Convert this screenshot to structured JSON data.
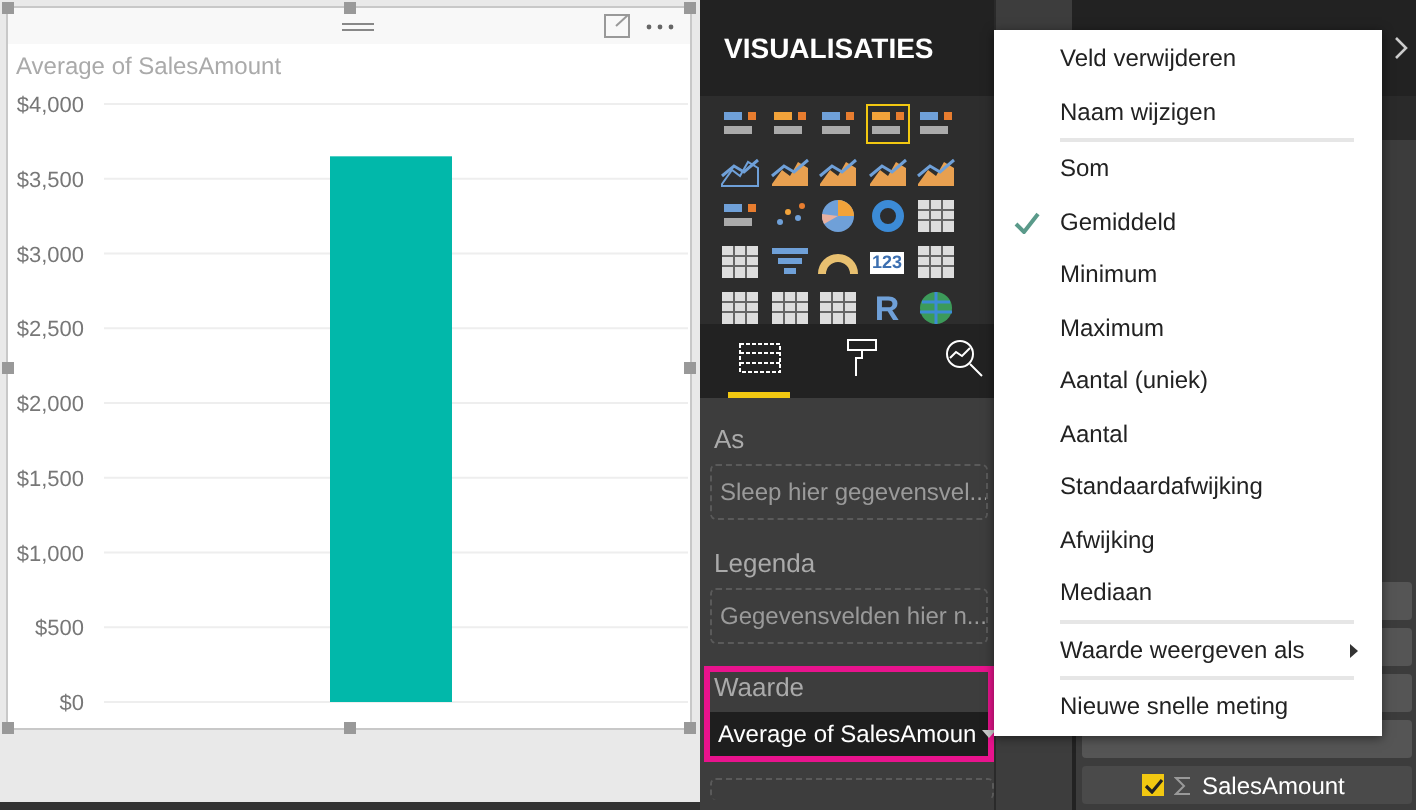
{
  "visual": {
    "title": "Average of SalesAmount",
    "chart_data": {
      "type": "bar",
      "grid": true,
      "values": [
        3650
      ],
      "ylim": [
        0,
        4000
      ],
      "yticks": [
        {
          "value": 0,
          "label": "$0"
        },
        {
          "value": 500,
          "label": "$500"
        },
        {
          "value": 1000,
          "label": "$1,000"
        },
        {
          "value": 1500,
          "label": "$1,500"
        },
        {
          "value": 2000,
          "label": "$2,000"
        },
        {
          "value": 2500,
          "label": "$2,500"
        },
        {
          "value": 3000,
          "label": "$3,000"
        },
        {
          "value": 3500,
          "label": "$3,500"
        },
        {
          "value": 4000,
          "label": "$4,000"
        }
      ]
    }
  },
  "visualizations": {
    "title": "VISUALISATIES",
    "types": [
      {
        "selected": false
      },
      {
        "selected": false
      },
      {
        "selected": false
      },
      {
        "selected": true
      },
      {
        "selected": false
      },
      {
        "selected": false
      },
      {
        "selected": false
      },
      {
        "selected": false
      },
      {
        "selected": false
      },
      {
        "selected": false
      },
      {
        "selected": false
      },
      {
        "selected": false
      },
      {
        "selected": false
      },
      {
        "selected": false
      },
      {
        "selected": false
      },
      {
        "selected": false
      },
      {
        "selected": false
      },
      {
        "selected": false
      },
      {
        "selected": false,
        "label": "123"
      },
      {
        "selected": false
      },
      {
        "selected": false
      },
      {
        "selected": false
      },
      {
        "selected": false
      },
      {
        "selected": false,
        "label": "R"
      },
      {
        "selected": false
      }
    ],
    "tabs": [
      {
        "selected": true
      },
      {
        "selected": false
      },
      {
        "selected": false
      }
    ],
    "wells": [
      {
        "label": "As",
        "placeholder": "Sleep hier gegevensvel...",
        "highlighted": false
      },
      {
        "label": "Legenda",
        "placeholder": "Gegevensvelden hier n...",
        "highlighted": false
      },
      {
        "label": "Waarde",
        "value": "Average of SalesAmoun",
        "highlighted": true
      }
    ]
  },
  "fields": [
    {
      "label": "SalesAmount",
      "checked": true
    }
  ],
  "menu": {
    "groups": [
      [
        {
          "label": "Veld verwijderen",
          "checked": false,
          "submenu": false
        },
        {
          "label": "Naam wijzigen",
          "checked": false,
          "submenu": false
        }
      ],
      [
        {
          "label": "Som",
          "checked": false,
          "submenu": false
        },
        {
          "label": "Gemiddeld",
          "checked": true,
          "submenu": false
        },
        {
          "label": "Minimum",
          "checked": false,
          "submenu": false
        },
        {
          "label": "Maximum",
          "checked": false,
          "submenu": false
        },
        {
          "label": "Aantal (uniek)",
          "checked": false,
          "submenu": false
        },
        {
          "label": "Aantal",
          "checked": false,
          "submenu": false
        },
        {
          "label": "Standaardafwijking",
          "checked": false,
          "submenu": false
        },
        {
          "label": "Afwijking",
          "checked": false,
          "submenu": false
        },
        {
          "label": "Mediaan",
          "checked": false,
          "submenu": false
        }
      ],
      [
        {
          "label": "Waarde weergeven als",
          "checked": false,
          "submenu": true
        }
      ],
      [
        {
          "label": "Nieuwe snelle meting",
          "checked": false,
          "submenu": false
        }
      ]
    ]
  }
}
